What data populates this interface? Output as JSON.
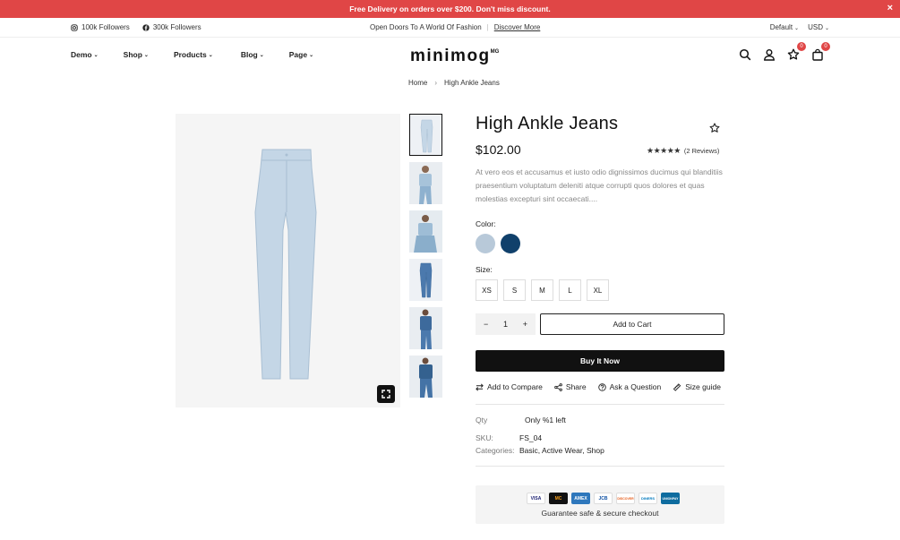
{
  "announcement": {
    "text": "Free Delivery on orders over $200. Don't miss discount.",
    "close": "×"
  },
  "topbar": {
    "instagram": "100k Followers",
    "facebook": "300k Followers",
    "promo": "Open Doors To A World Of Fashion",
    "separator": "|",
    "discover": "Discover More",
    "language": "Default",
    "currency": "USD"
  },
  "nav": {
    "items": [
      "Demo",
      "Shop",
      "Products",
      "Blog",
      "Page"
    ],
    "logo": "minimog",
    "logo_sup": "MG",
    "wishlist_count": "0",
    "cart_count": "0"
  },
  "breadcrumb": {
    "home": "Home",
    "current": "High Ankle Jeans"
  },
  "product": {
    "title": "High Ankle Jeans",
    "price": "$102.00",
    "stars": "★★★★★",
    "reviews": "(2  Reviews)",
    "description": "At vero eos et accusamus et iusto odio dignissimos ducimus qui blanditiis praesentium voluptatum deleniti atque corrupti quos dolores et quas molestias excepturi sint occaecati....",
    "color_label": "Color:",
    "size_label": "Size:",
    "sizes": [
      "XS",
      "S",
      "M",
      "L",
      "XL"
    ],
    "quantity": "1",
    "qty_minus": "−",
    "qty_plus": "+",
    "add_to_cart": "Add to Cart",
    "buy_now": "Buy It Now",
    "actions": [
      "Add to Compare",
      "Share",
      "Ask a Question",
      "Size guide"
    ],
    "qty_key": "Qty",
    "qty_value": "Only %1 left",
    "sku_key": "SKU:",
    "sku_value": "FS_04",
    "categories_key": "Categories:",
    "categories_value": "Basic, Active Wear, Shop",
    "guarantee": "Guarantee safe & secure checkout"
  },
  "payment_cards": [
    "VISA",
    "MC",
    "AMEX",
    "JCB",
    "DISCOVER",
    "DINERS",
    "UNIONPAY"
  ],
  "colors": {
    "accent": "#e04646",
    "swatch_light": "#b8c9d9",
    "swatch_dark": "#10406b",
    "jeans": "#c4d6e6"
  }
}
